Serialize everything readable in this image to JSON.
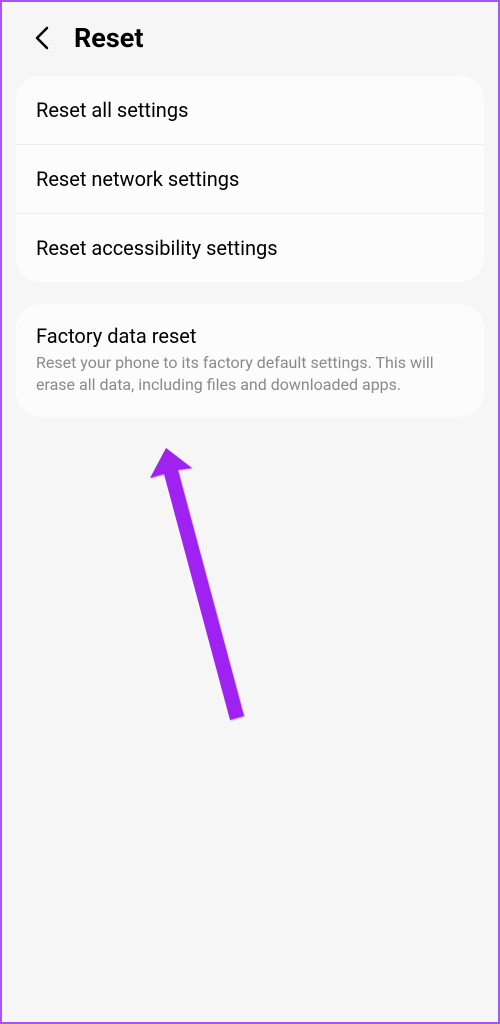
{
  "header": {
    "title": "Reset"
  },
  "groups": [
    {
      "items": [
        {
          "label": "Reset all settings"
        },
        {
          "label": "Reset network settings"
        },
        {
          "label": "Reset accessibility settings"
        }
      ]
    },
    {
      "items": [
        {
          "label": "Factory data reset",
          "description": "Reset your phone to its factory default settings. This will erase all data, including files and downloaded apps."
        }
      ]
    }
  ],
  "annotation": {
    "color": "#a020f0"
  }
}
